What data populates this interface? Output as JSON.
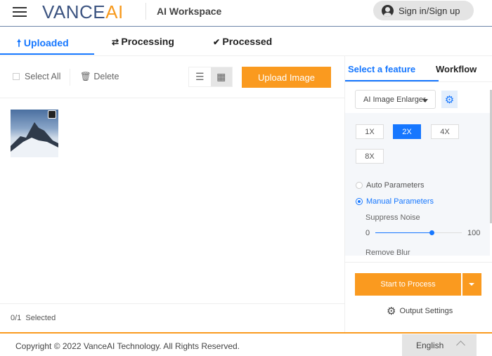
{
  "header": {
    "logo_main": "VANCE",
    "logo_accent": "AI",
    "title": "AI Workspace",
    "signin": "Sign in/Sign up"
  },
  "tabs": [
    {
      "label": "Uploaded",
      "icon": "arrow-up-icon",
      "active": true
    },
    {
      "label": "Processing",
      "icon": "refresh-icon"
    },
    {
      "label": "Processed",
      "icon": "check-circle-icon"
    }
  ],
  "toolbar": {
    "select_all": "Select All",
    "delete": "Delete",
    "upload": "Upload Image"
  },
  "status": {
    "selected": "0/1  Selected"
  },
  "right": {
    "tabs": [
      "Select a feature",
      "Workflow"
    ],
    "feature": "AI Image Enlarger",
    "scales": [
      "1X",
      "2X",
      "4X",
      "8X"
    ],
    "selected_scale": "2X",
    "auto": "Auto Parameters",
    "manual": "Manual Parameters",
    "suppress_noise": "Suppress Noise",
    "slider_min": "0",
    "slider_max": "100",
    "slider_value": 65,
    "remove_blur": "Remove Blur",
    "start": "Start to Process",
    "output_settings": "Output Settings"
  },
  "footer": {
    "copyright": "Copyright © 2022 VanceAI Technology. All Rights Reserved.",
    "language": "English"
  },
  "colors": {
    "accent": "#fa9a1f",
    "primary": "#1677ff",
    "logo": "#3c5481"
  }
}
